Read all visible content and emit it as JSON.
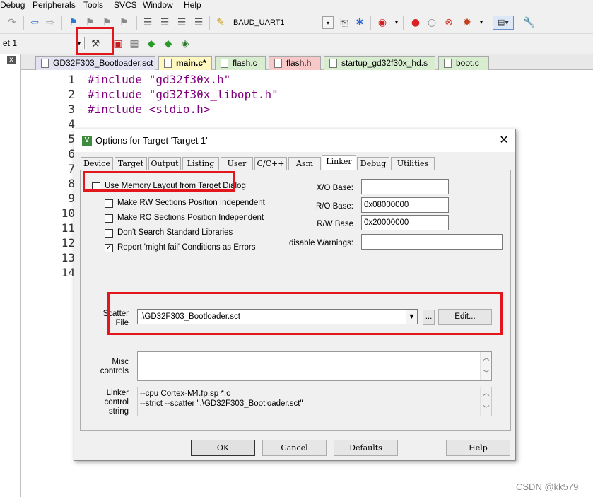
{
  "menubar": {
    "items": [
      "Debug",
      "Peripherals",
      "Tools",
      "SVCS",
      "Window",
      "Help"
    ]
  },
  "toolbar": {
    "uart_combo": "BAUD_UART1",
    "target_combo": "et 1"
  },
  "file_tabs": [
    "GD32F303_Bootloader.sct",
    "main.c*",
    "flash.c",
    "flash.h",
    "startup_gd32f30x_hd.s",
    "boot.c"
  ],
  "file_tab_colors": [
    "#e2e2f2",
    "#fff8c0",
    "#d8ecd0",
    "#f8c8c8",
    "#d8ecd0",
    "#d8ecd0"
  ],
  "editor": {
    "line_numbers": [
      "1",
      "2",
      "3",
      "4",
      "5",
      "6",
      "7",
      "8",
      "9",
      "10",
      "11",
      "12",
      "13",
      "14"
    ],
    "lines": [
      {
        "kw": "#include",
        "arg": "\"gd32f30x.h\""
      },
      {
        "kw": "#include",
        "arg": "\"gd32f30x_libopt.h\""
      },
      {
        "kw": "#include",
        "arg": "<stdio.h>"
      }
    ]
  },
  "dialog": {
    "title": "Options for Target 'Target 1'",
    "tabs": [
      "Device",
      "Target",
      "Output",
      "Listing",
      "User",
      "C/C++",
      "Asm",
      "Linker",
      "Debug",
      "Utilities"
    ],
    "active_tab": "Linker",
    "checkboxes": [
      {
        "label": "Use Memory Layout from Target Dialog",
        "checked": false
      },
      {
        "label": "Make RW Sections Position Independent",
        "checked": false
      },
      {
        "label": "Make RO Sections Position Independent",
        "checked": false
      },
      {
        "label": "Don't Search Standard Libraries",
        "checked": false
      },
      {
        "label": "Report 'might fail' Conditions as Errors",
        "checked": true
      }
    ],
    "check_mark": "✓",
    "xo_base": {
      "label": "X/O Base:",
      "value": ""
    },
    "ro_base": {
      "label": "R/O Base:",
      "value": "0x08000000"
    },
    "rw_base": {
      "label": "R/W Base",
      "value": "0x20000000"
    },
    "disable_warnings": {
      "label": "disable Warnings:",
      "value": ""
    },
    "scatter": {
      "label_line1": "Scatter",
      "label_line2": "File",
      "value": ".\\GD32F303_Bootloader.sct",
      "browse_label": "...",
      "edit_label": "Edit..."
    },
    "misc": {
      "label_line1": "Misc",
      "label_line2": "controls",
      "value": ""
    },
    "linker": {
      "label_line1": "Linker",
      "label_line2": "control",
      "label_line3": "string",
      "line1": "--cpu Cortex-M4.fp.sp *.o",
      "line2": "--strict --scatter \".\\GD32F303_Bootloader.sct\""
    },
    "buttons": {
      "ok": "OK",
      "cancel": "Cancel",
      "defaults": "Defaults",
      "help": "Help"
    }
  },
  "watermark": "CSDN @kk579",
  "colors": {
    "highlight_red": "#e3161d",
    "keyword": "#800080"
  }
}
